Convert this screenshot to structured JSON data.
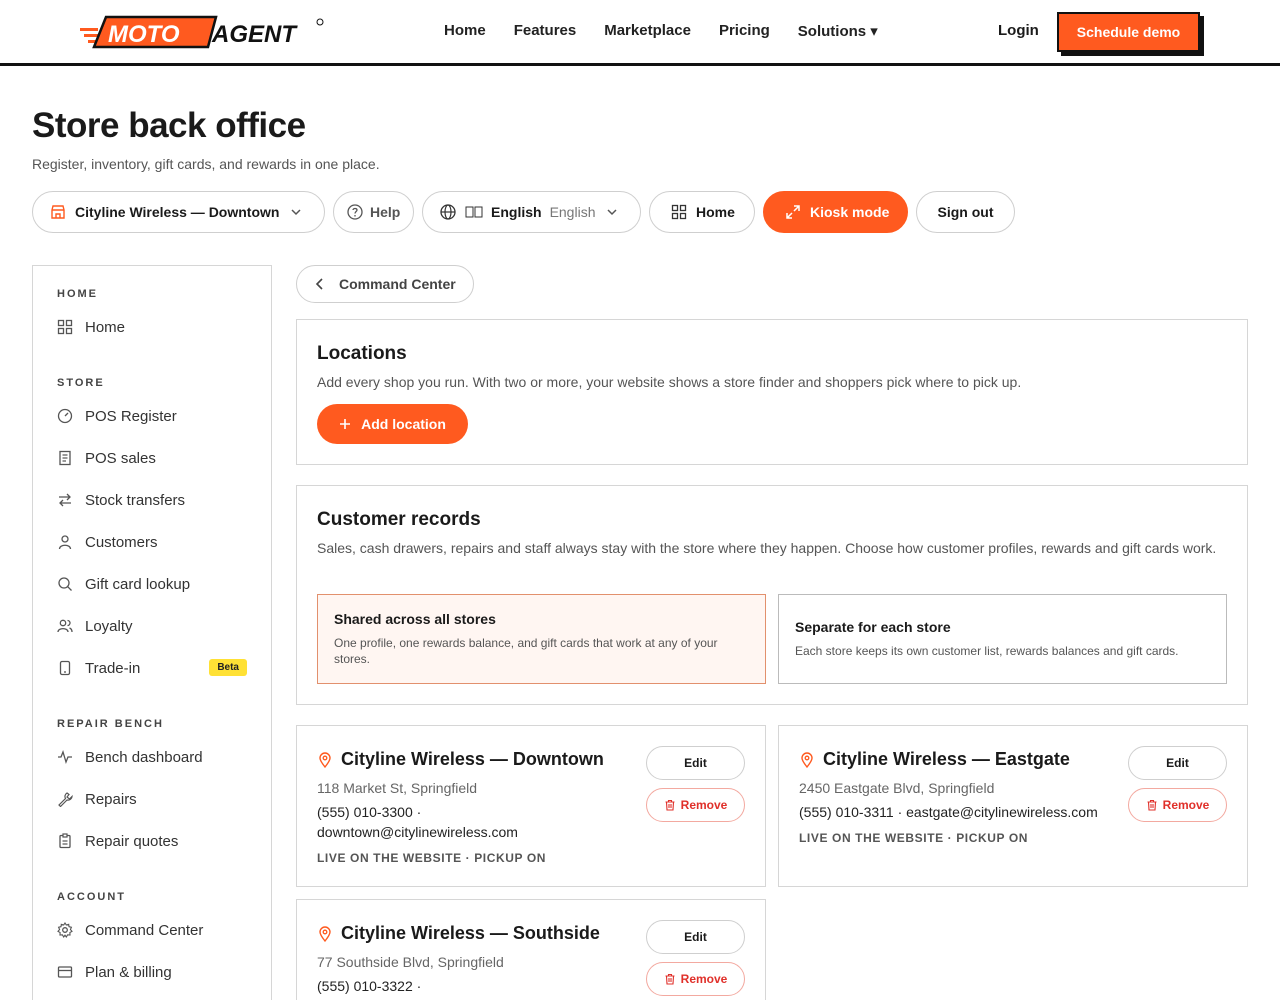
{
  "brand": {
    "name_left": "MOTO",
    "name_right": "AGENT",
    "accent": "#ff5a1f"
  },
  "nav": {
    "links": [
      "Home",
      "Features",
      "Marketplace",
      "Pricing",
      "Solutions ▾"
    ],
    "login": "Login",
    "schedule": "Schedule demo"
  },
  "header": {
    "title": "Store back office",
    "subtitle": "Register, inventory, gift cards, and rewards in one place."
  },
  "toolbar": {
    "store": "Cityline Wireless — Downtown",
    "help": "Help",
    "lang_primary": "English",
    "lang_secondary": "English",
    "home": "Home",
    "kiosk": "Kiosk mode",
    "signout": "Sign out"
  },
  "sidebar": {
    "sections": {
      "home": "HOME",
      "store": "STORE",
      "repair": "REPAIR BENCH",
      "account": "ACCOUNT"
    },
    "items": {
      "home": "Home",
      "pos_register": "POS Register",
      "pos_sales": "POS sales",
      "stock_transfers": "Stock transfers",
      "customers": "Customers",
      "gift_card_lookup": "Gift card lookup",
      "loyalty": "Loyalty",
      "trade_in": "Trade-in",
      "trade_in_badge": "Beta",
      "bench_dashboard": "Bench dashboard",
      "repairs": "Repairs",
      "repair_quotes": "Repair quotes",
      "command_center": "Command Center",
      "plan_billing": "Plan & billing"
    }
  },
  "back": {
    "label": "Command Center"
  },
  "locations": {
    "title": "Locations",
    "desc": "Add every shop you run. With two or more, your website shows a store finder and shoppers pick where to pick up.",
    "add": "Add location"
  },
  "customer_records": {
    "title": "Customer records",
    "desc": "Sales, cash drawers, repairs and staff always stay with the store where they happen. Choose how customer profiles, rewards and gift cards work.",
    "shared_title": "Shared across all stores",
    "shared_desc": "One profile, one rewards balance, and gift cards that work at any of your stores.",
    "separate_title": "Separate for each store",
    "separate_desc": "Each store keeps its own customer list, rewards balances and gift cards."
  },
  "stores": [
    {
      "name": "Cityline Wireless — Downtown",
      "address": "118 Market St, Springfield",
      "phone": "(555) 010-3300 ·",
      "email": "downtown@citylinewireless.com",
      "status": "LIVE ON THE WEBSITE · PICKUP ON",
      "edit": "Edit",
      "remove": "Remove"
    },
    {
      "name": "Cityline Wireless — Eastgate",
      "address": "2450 Eastgate Blvd, Springfield",
      "contact": "(555) 010-3311 · eastgate@citylinewireless.com",
      "status": "LIVE ON THE WEBSITE · PICKUP ON",
      "edit": "Edit",
      "remove": "Remove"
    },
    {
      "name": "Cityline Wireless — Southside",
      "address": "77 Southside Blvd, Springfield",
      "phone": "(555) 010-3322 ·",
      "edit": "Edit",
      "remove": "Remove"
    }
  ]
}
